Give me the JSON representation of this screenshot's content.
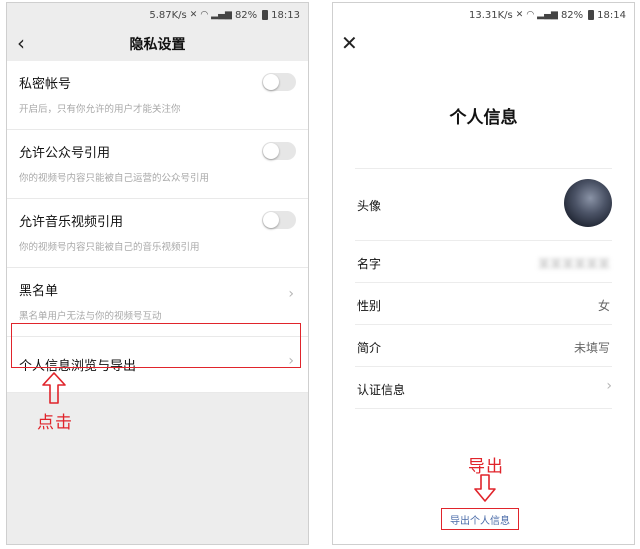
{
  "left_screen": {
    "status": {
      "speed": "5.87K/s",
      "battery": "82%",
      "time": "18:13"
    },
    "title": "隐私设置",
    "rows": [
      {
        "label": "私密帐号",
        "desc": "开启后，只有你允许的用户才能关注你"
      },
      {
        "label": "允许公众号引用",
        "desc": "你的视频号内容只能被自己运营的公众号引用"
      },
      {
        "label": "允许音乐视频引用",
        "desc": "你的视频号内容只能被自己的音乐视频引用"
      },
      {
        "label": "黑名单",
        "desc": "黑名单用户无法与你的视频号互动"
      },
      {
        "label": "个人信息浏览与导出"
      }
    ],
    "annotation": "点击"
  },
  "right_screen": {
    "status": {
      "speed": "13.31K/s",
      "battery": "82%",
      "time": "18:14"
    },
    "title": "个人信息",
    "rows": [
      {
        "label": "头像"
      },
      {
        "label": "名字",
        "value": "某某某某某某"
      },
      {
        "label": "性别",
        "value": "女"
      },
      {
        "label": "简介",
        "value": "未填写"
      },
      {
        "label": "认证信息"
      }
    ],
    "annotation": "导出",
    "export_link": "导出个人信息"
  },
  "colors": {
    "annotation_red": "#e0242b",
    "link_blue": "#4a6ba8"
  },
  "icons": [
    "back-arrow-icon",
    "close-icon",
    "chevron-right-icon",
    "up-arrow-icon",
    "down-arrow-icon"
  ]
}
